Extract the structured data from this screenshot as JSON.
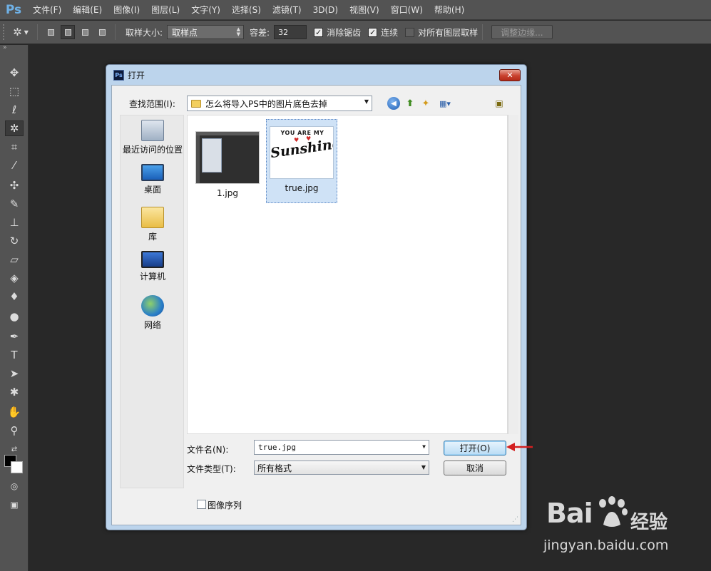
{
  "app": {
    "logo": "Ps"
  },
  "menu": [
    "文件(F)",
    "编辑(E)",
    "图像(I)",
    "图层(L)",
    "文字(Y)",
    "选择(S)",
    "滤镜(T)",
    "3D(D)",
    "视图(V)",
    "窗口(W)",
    "帮助(H)"
  ],
  "options": {
    "sample_size_label": "取样大小:",
    "sample_size_value": "取样点",
    "tolerance_label": "容差:",
    "tolerance_value": "32",
    "antialias_label": "消除锯齿",
    "antialias_checked": true,
    "contiguous_label": "连续",
    "contiguous_checked": true,
    "all_layers_label": "对所有图层取样",
    "all_layers_checked": false,
    "refine_edge_label": "调整边缘..."
  },
  "tools": [
    "move-icon",
    "marquee-icon",
    "lasso-icon",
    "magic-wand-icon",
    "crop-icon",
    "eyedropper-icon",
    "healing-icon",
    "brush-icon",
    "stamp-icon",
    "history-brush-icon",
    "eraser-icon",
    "paint-bucket-icon",
    "blur-icon",
    "dodge-icon",
    "pen-icon",
    "type-icon",
    "path-select-icon",
    "shape-icon",
    "hand-icon",
    "zoom-icon"
  ],
  "dialog": {
    "title": "打开",
    "look_in_label": "查找范围(I):",
    "look_in_value": "怎么将导入PS中的图片底色去掉",
    "places": [
      {
        "label": "最近访问的位置",
        "icon": "recent-places-icon"
      },
      {
        "label": "桌面",
        "icon": "desktop-icon"
      },
      {
        "label": "库",
        "icon": "libraries-icon"
      },
      {
        "label": "计算机",
        "icon": "computer-icon"
      },
      {
        "label": "网络",
        "icon": "network-icon"
      }
    ],
    "files": [
      {
        "name": "1.jpg",
        "selected": false
      },
      {
        "name": "true.jpg",
        "selected": true
      }
    ],
    "thumb_text": {
      "arc": "YOU ARE MY",
      "script": "Sunshine"
    },
    "file_name_label": "文件名(N):",
    "file_name_value": "true.jpg",
    "file_type_label": "文件类型(T):",
    "file_type_value": "所有格式",
    "open_button": "打开(O)",
    "cancel_button": "取消",
    "image_sequence_label": "图像序列",
    "image_sequence_checked": false
  },
  "watermark": {
    "brand": "Bai",
    "brand2": "经验",
    "url": "jingyan.baidu.com"
  },
  "colors": {
    "ui_dark": "#535353",
    "canvas": "#282828",
    "dialog_frame": "#bcd4ec",
    "accent_arrow": "#d42020"
  }
}
